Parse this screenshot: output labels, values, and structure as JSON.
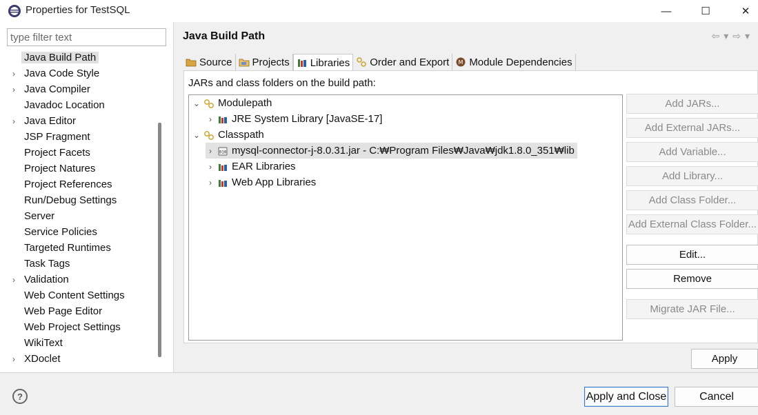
{
  "window": {
    "title": "Properties for TestSQL",
    "controls": [
      "—",
      "☐",
      "✕"
    ]
  },
  "filter": {
    "placeholder": "type filter text",
    "value": ""
  },
  "sidebar": {
    "items": [
      {
        "label": "Java Build Path",
        "expandable": false,
        "selected": true
      },
      {
        "label": "Java Code Style",
        "expandable": true
      },
      {
        "label": "Java Compiler",
        "expandable": true
      },
      {
        "label": "Javadoc Location",
        "expandable": false
      },
      {
        "label": "Java Editor",
        "expandable": true
      },
      {
        "label": "JSP Fragment",
        "expandable": false
      },
      {
        "label": "Project Facets",
        "expandable": false
      },
      {
        "label": "Project Natures",
        "expandable": false
      },
      {
        "label": "Project References",
        "expandable": false
      },
      {
        "label": "Run/Debug Settings",
        "expandable": false
      },
      {
        "label": "Server",
        "expandable": false
      },
      {
        "label": "Service Policies",
        "expandable": false
      },
      {
        "label": "Targeted Runtimes",
        "expandable": false
      },
      {
        "label": "Task Tags",
        "expandable": false
      },
      {
        "label": "Validation",
        "expandable": true
      },
      {
        "label": "Web Content Settings",
        "expandable": false
      },
      {
        "label": "Web Page Editor",
        "expandable": false
      },
      {
        "label": "Web Project Settings",
        "expandable": false
      },
      {
        "label": "WikiText",
        "expandable": false
      },
      {
        "label": "XDoclet",
        "expandable": true
      }
    ]
  },
  "header": {
    "title": "Java Build Path"
  },
  "tabs": [
    {
      "label": "Source",
      "icon": "source-folder-icon"
    },
    {
      "label": "Projects",
      "icon": "projects-icon"
    },
    {
      "label": "Libraries",
      "icon": "libraries-icon",
      "active": true
    },
    {
      "label": "Order and Export",
      "icon": "order-export-icon"
    },
    {
      "label": "Module Dependencies",
      "icon": "module-icon"
    }
  ],
  "content": {
    "label": "JARs and class folders on the build path:",
    "tree": {
      "modulepath": {
        "label": "Modulepath",
        "children": [
          "JRE System Library [JavaSE-17]"
        ]
      },
      "classpath": {
        "label": "Classpath",
        "children": [
          "mysql-connector-j-8.0.31.jar - C:₩Program Files₩Java₩jdk1.8.0_351₩lib",
          "EAR Libraries",
          "Web App Libraries"
        ]
      }
    }
  },
  "buttons": {
    "add_jars": "Add JARs...",
    "add_external_jars": "Add External JARs...",
    "add_variable": "Add Variable...",
    "add_library": "Add Library...",
    "add_class_folder": "Add Class Folder...",
    "add_external_class_folder": "Add External Class Folder...",
    "edit": "Edit...",
    "remove": "Remove",
    "migrate_jar": "Migrate JAR File...",
    "apply": "Apply"
  },
  "footer": {
    "help": "?",
    "apply_and_close": "Apply and Close",
    "cancel": "Cancel"
  },
  "colors": {
    "selection": "#e0e0e0",
    "primary_border": "#3a78c8",
    "disabled_text": "#8a8a8a"
  }
}
